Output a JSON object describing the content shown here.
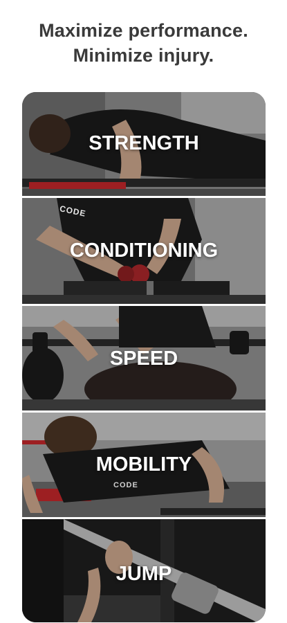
{
  "headline": {
    "line1": "Maximize performance.",
    "line2": "Minimize injury."
  },
  "categories": [
    {
      "label": "STRENGTH"
    },
    {
      "label": "CONDITIONING"
    },
    {
      "label": "SPEED"
    },
    {
      "label": "MOBILITY"
    },
    {
      "label": "JUMP"
    }
  ],
  "photo_text": {
    "shirt_brand": "CODE"
  },
  "colors": {
    "headline": "#3a3a3a",
    "label": "#ffffff",
    "accent_red": "#c0262a"
  }
}
